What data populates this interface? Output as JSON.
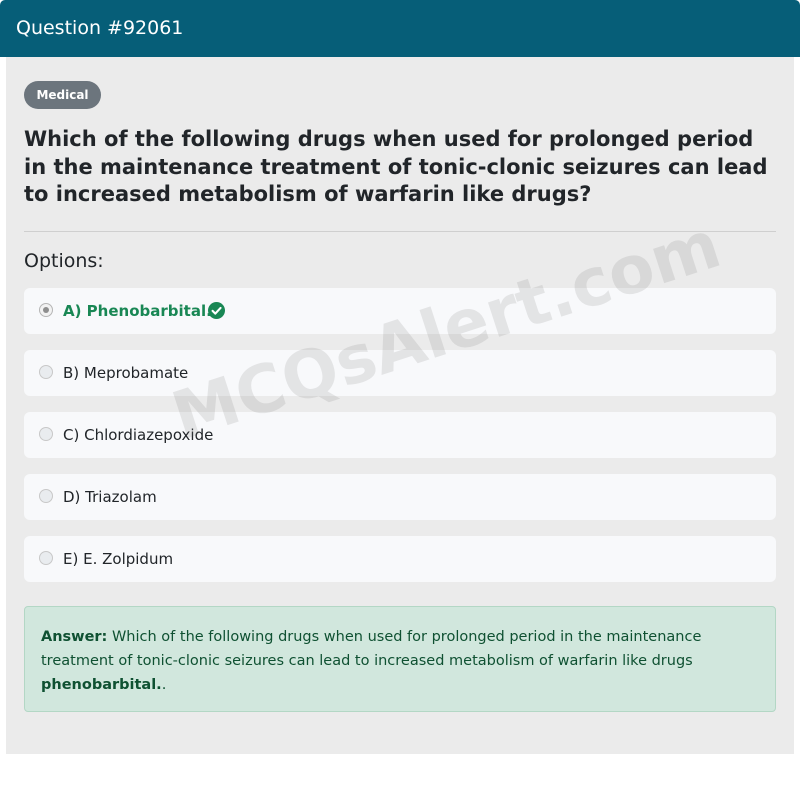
{
  "header": {
    "title": "Question #92061",
    "color": "#065e78"
  },
  "badge": "Medical",
  "question": "Which of the following drugs when used for prolonged period in the maintenance treatment of tonic-clonic seizures can lead to increased metabolism of warfarin like drugs?",
  "options_label": "Options:",
  "options": [
    {
      "label": "A) Phenobarbital.",
      "selected": true,
      "correct": true
    },
    {
      "label": "B) Meprobamate",
      "selected": false,
      "correct": false
    },
    {
      "label": "C) Chlordiazepoxide",
      "selected": false,
      "correct": false
    },
    {
      "label": "D) Triazolam",
      "selected": false,
      "correct": false
    },
    {
      "label": "E) E. Zolpidum",
      "selected": false,
      "correct": false
    }
  ],
  "answer": {
    "prefix": "Answer:",
    "text": " Which of the following drugs when used for prolonged period in the maintenance treatment of tonic-clonic seizures can lead to increased metabolism of warfarin like drugs ",
    "bold_answer": "phenobarbital.",
    "suffix": "."
  },
  "watermark": "MCQsAlert.com",
  "colors": {
    "correct": "#198754",
    "answer_bg": "#d1e7dd"
  }
}
